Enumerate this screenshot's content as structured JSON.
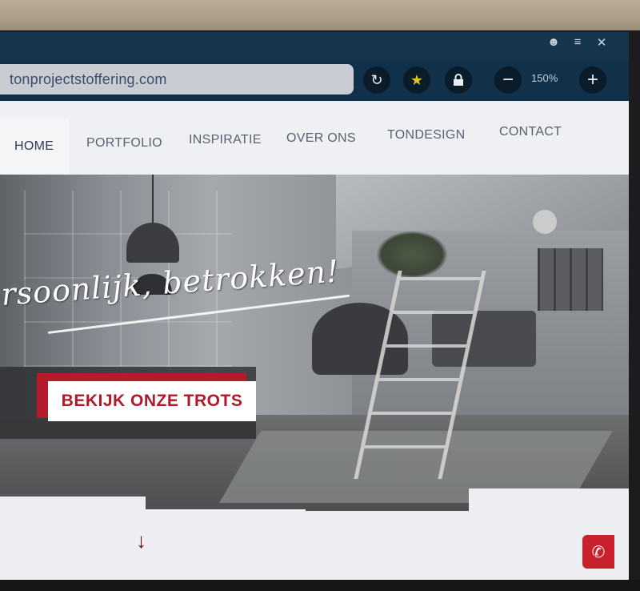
{
  "browser": {
    "url": "tonprojectstoffering.com",
    "zoom": "150%",
    "window_controls": [
      "user-icon",
      "menu-icon",
      "close-icon"
    ],
    "toolbar_icons": [
      "reload-icon",
      "star-icon",
      "lock-icon",
      "zoom-out-icon",
      "zoom-in-icon"
    ]
  },
  "nav": {
    "items": [
      "HOME",
      "PORTFOLIO",
      "INSPIRATIE",
      "OVER ONS",
      "TONDESIGN",
      "CONTACT"
    ],
    "active": "HOME"
  },
  "hero": {
    "slogan": "rsoonlijk, betrokken!",
    "cta": "BEKIJK ONZE TROTS"
  },
  "colors": {
    "accent": "#b51c2a",
    "toolbar": "#113049",
    "url_bar": "#c9ccd3"
  }
}
